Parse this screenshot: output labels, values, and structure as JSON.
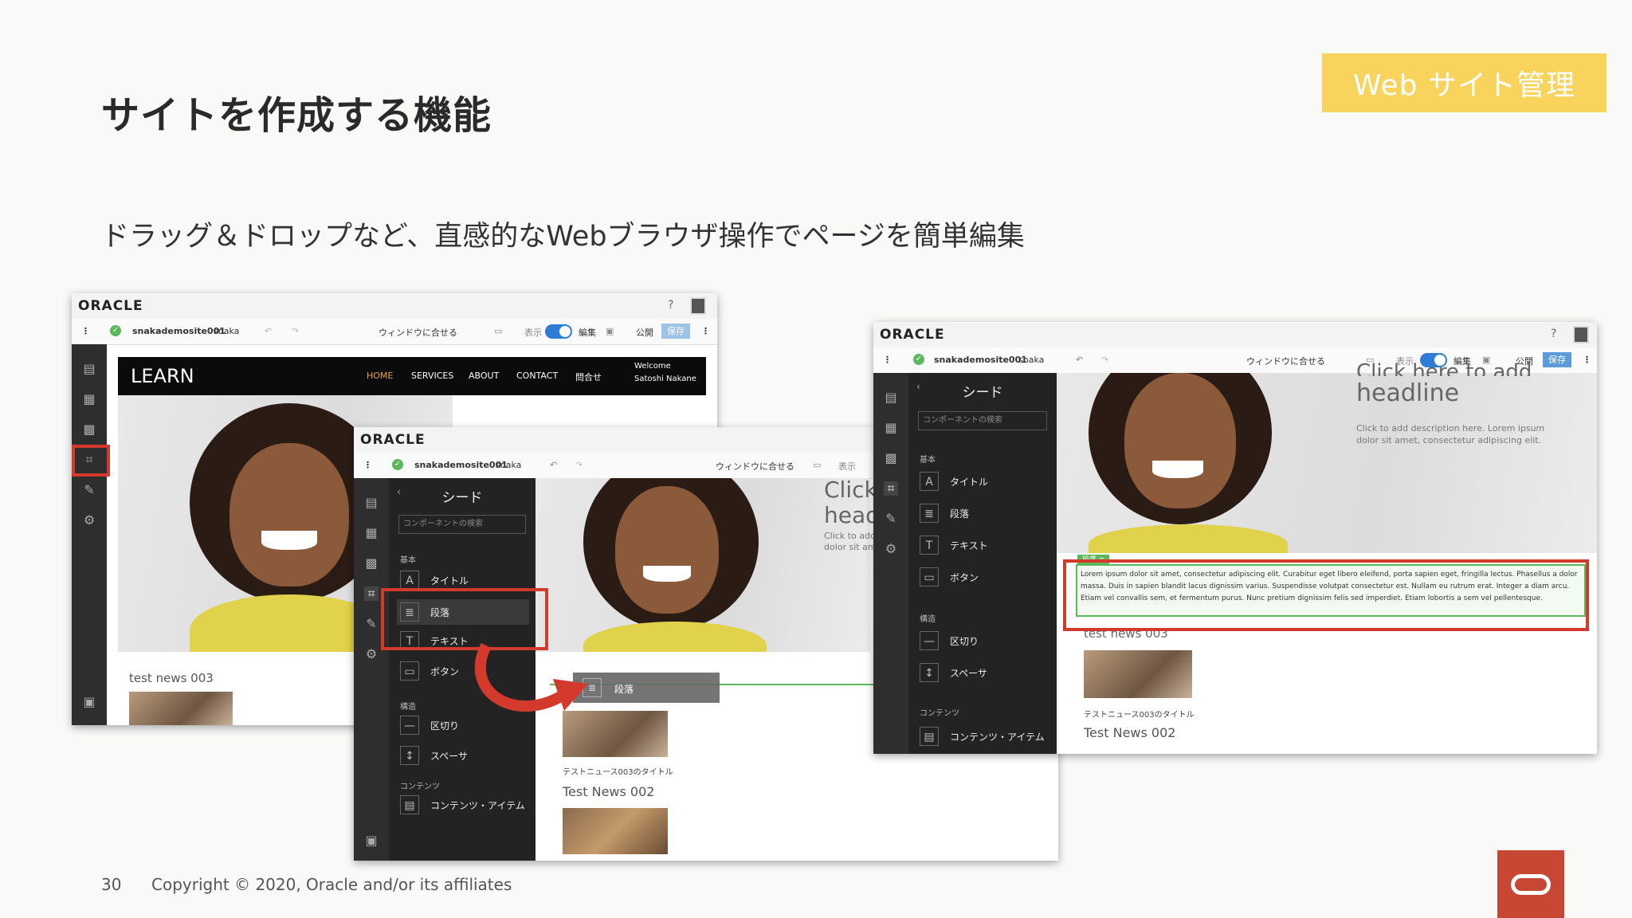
{
  "slide": {
    "title": "サイトを作成する機能",
    "subtitle": "ドラッグ＆ドロップなど、直感的なWebブラウザ操作でページを簡単編集",
    "badge": "Web サイト管理",
    "page_number": "30",
    "copyright": "Copyright © 2020, Oracle and/or its affiliates"
  },
  "app": {
    "logo": "ORACLE",
    "help": "?",
    "site_name": "snakademosite001",
    "user": "snaka",
    "fit_window": "ウィンドウに合せる",
    "view": "表示",
    "edit": "編集",
    "publish": "公開",
    "save": "保存"
  },
  "site_preview": {
    "brand": "LEARN",
    "nav": [
      "HOME",
      "SERVICES",
      "ABOUT",
      "CONTACT",
      "問合せ"
    ],
    "welcome_line1": "Welcome",
    "welcome_line2": "Satoshi Nakane",
    "news_003": "test news 003",
    "news_003_title": "テストニュース003のタイトル",
    "news_002": "Test News 002",
    "headline_partial": "Click here to add headline",
    "headline_a": "Click",
    "headline_b": "head",
    "desc_partial_a": "Click to add",
    "desc_partial_b": "dolor sit am",
    "description": "Click to add description here. Lorem ipsum dolor sit amet, consectetur adipiscing elit.",
    "headline_top": "Click here to add",
    "headline_bottom": "headline",
    "paragraph_tag": "段落",
    "paragraph_text": "Lorem ipsum dolor sit amet, consectetur adipiscing elit. Curabitur eget libero eleifend, porta sapien eget, fringilla lectus. Phasellus a dolor massa. Duis in sapien blandit lacus dignissim varius. Suspendisse volutpat consectetur est. Nullam eu rutrum erat. Integer a diam arcu. Etiam vel convallis sem, et fermentum purus. Nunc pretium dignissim felis sed imperdiet. Etiam lobortis a sem vel pellentesque."
  },
  "panel": {
    "header": "シード",
    "search_placeholder": "コンポーネントの検索",
    "section_basic": "基本",
    "section_structure": "構造",
    "section_content": "コンテンツ",
    "items": {
      "title": "タイトル",
      "paragraph": "段落",
      "text": "テキスト",
      "button": "ボタン",
      "divider": "区切り",
      "spacer": "スペーサ",
      "content_item": "コンテンツ・アイテム"
    },
    "drag_label": "段落"
  },
  "colors": {
    "badge": "#f8d45c",
    "highlight_red": "#d33a2c",
    "oracle_red": "#c74634",
    "toggle_blue": "#2e7cd6"
  }
}
